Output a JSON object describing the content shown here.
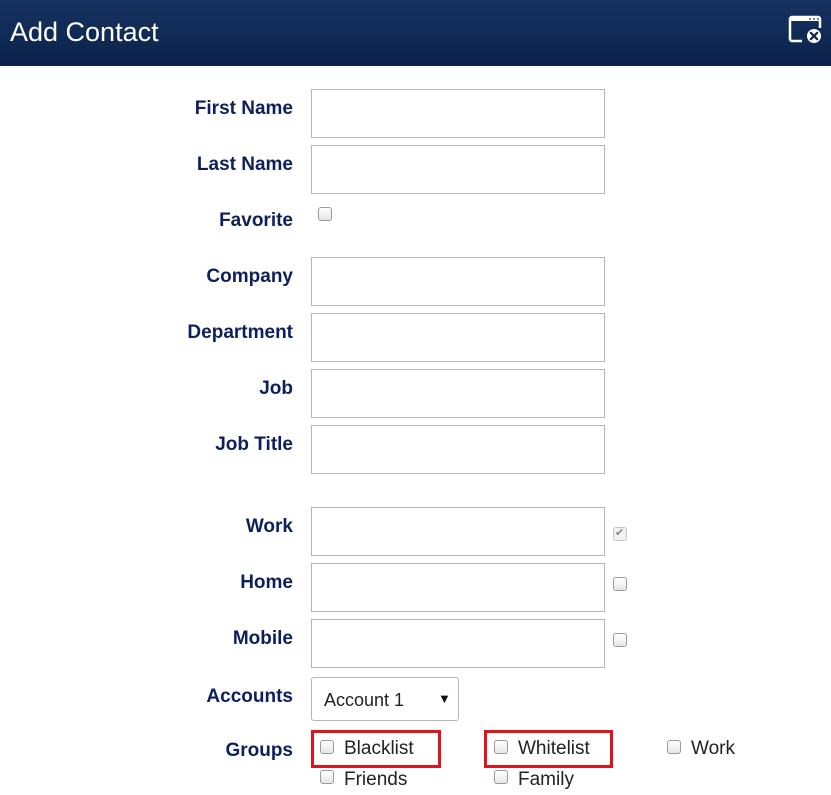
{
  "dialog": {
    "title": "Add Contact",
    "close_icon": "window-close-icon"
  },
  "fields": {
    "first_name": {
      "label": "First Name",
      "value": ""
    },
    "last_name": {
      "label": "Last Name",
      "value": ""
    },
    "favorite": {
      "label": "Favorite",
      "checked": false
    },
    "company": {
      "label": "Company",
      "value": ""
    },
    "department": {
      "label": "Department",
      "value": ""
    },
    "job": {
      "label": "Job",
      "value": ""
    },
    "job_title": {
      "label": "Job Title",
      "value": ""
    }
  },
  "phones": {
    "work": {
      "label": "Work",
      "value": "",
      "primary": true
    },
    "home": {
      "label": "Home",
      "value": "",
      "primary": false
    },
    "mobile": {
      "label": "Mobile",
      "value": "",
      "primary": false
    }
  },
  "accounts": {
    "label": "Accounts",
    "selected": "Account 1"
  },
  "groups": {
    "label": "Groups",
    "items": [
      {
        "label": "Blacklist",
        "checked": false,
        "highlighted": true
      },
      {
        "label": "Whitelist",
        "checked": false,
        "highlighted": true
      },
      {
        "label": "Work",
        "checked": false,
        "highlighted": false
      },
      {
        "label": "Friends",
        "checked": false,
        "highlighted": false
      },
      {
        "label": "Family",
        "checked": false,
        "highlighted": false
      }
    ]
  },
  "colors": {
    "titlebar": "#0f2a55",
    "label": "#0d1f5c",
    "highlight": "#e0121b"
  }
}
